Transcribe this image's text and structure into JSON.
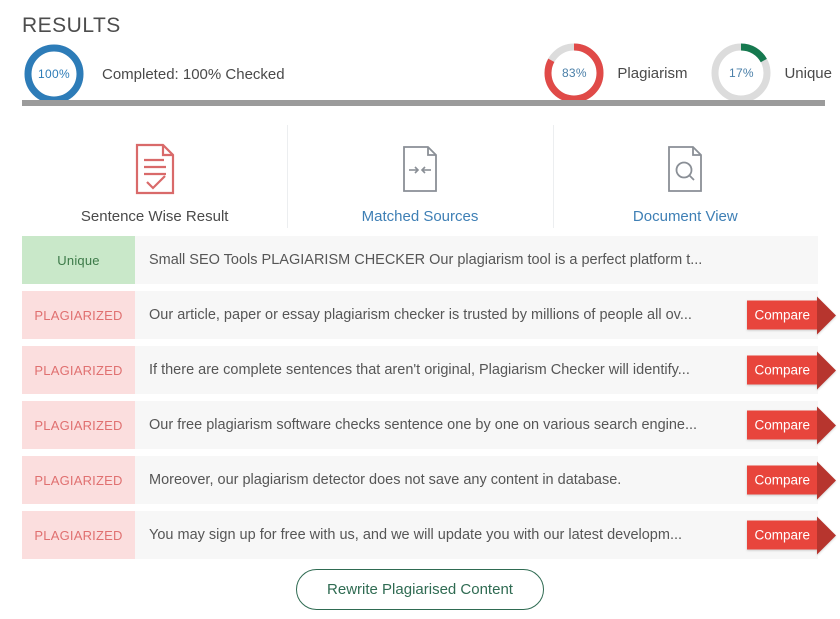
{
  "header": {
    "title": "RESULTS",
    "progress": {
      "gauge_label": "100%",
      "percent": 100,
      "color": "#2d7cb8",
      "track": "#e8e8e8",
      "text": "Completed: 100% Checked"
    },
    "scores": [
      {
        "gauge_label": "83%",
        "percent": 83,
        "name": "Plagiarism",
        "color": "#e04a48",
        "track": "#dcdcdc"
      },
      {
        "gauge_label": "17%",
        "percent": 17,
        "name": "Unique",
        "color": "#16794f",
        "track": "#dcdcdc"
      }
    ]
  },
  "tabs": [
    {
      "label": "Sentence Wise Result",
      "icon": "document-check-icon",
      "active": true
    },
    {
      "label": "Matched Sources",
      "icon": "document-arrows-icon",
      "active": false
    },
    {
      "label": "Document View",
      "icon": "document-search-icon",
      "active": false
    }
  ],
  "results": {
    "compare_label": "Compare",
    "rows": [
      {
        "status": "Unique",
        "status_type": "unique",
        "text": "Small SEO Tools PLAGIARISM CHECKER Our plagiarism tool is a perfect platform t...",
        "has_compare": false
      },
      {
        "status": "PLAGIARIZED",
        "status_type": "plagiarized",
        "text": "Our article, paper or essay plagiarism checker is trusted by millions of people all ov...",
        "has_compare": true
      },
      {
        "status": "PLAGIARIZED",
        "status_type": "plagiarized",
        "text": "If there are complete sentences that aren't original, Plagiarism Checker will identify...",
        "has_compare": true
      },
      {
        "status": "PLAGIARIZED",
        "status_type": "plagiarized",
        "text": "Our free plagiarism software checks sentence one by one on various search engine...",
        "has_compare": true
      },
      {
        "status": "PLAGIARIZED",
        "status_type": "plagiarized",
        "text": "Moreover, our plagiarism detector does not save any content in database.",
        "has_compare": true
      },
      {
        "status": "PLAGIARIZED",
        "status_type": "plagiarized",
        "text": "You may sign up for free with us, and we will update you with our latest developm...",
        "has_compare": true
      }
    ]
  },
  "footer": {
    "rewrite_label": "Rewrite Plagiarised Content",
    "accent": "#2f6b52"
  }
}
